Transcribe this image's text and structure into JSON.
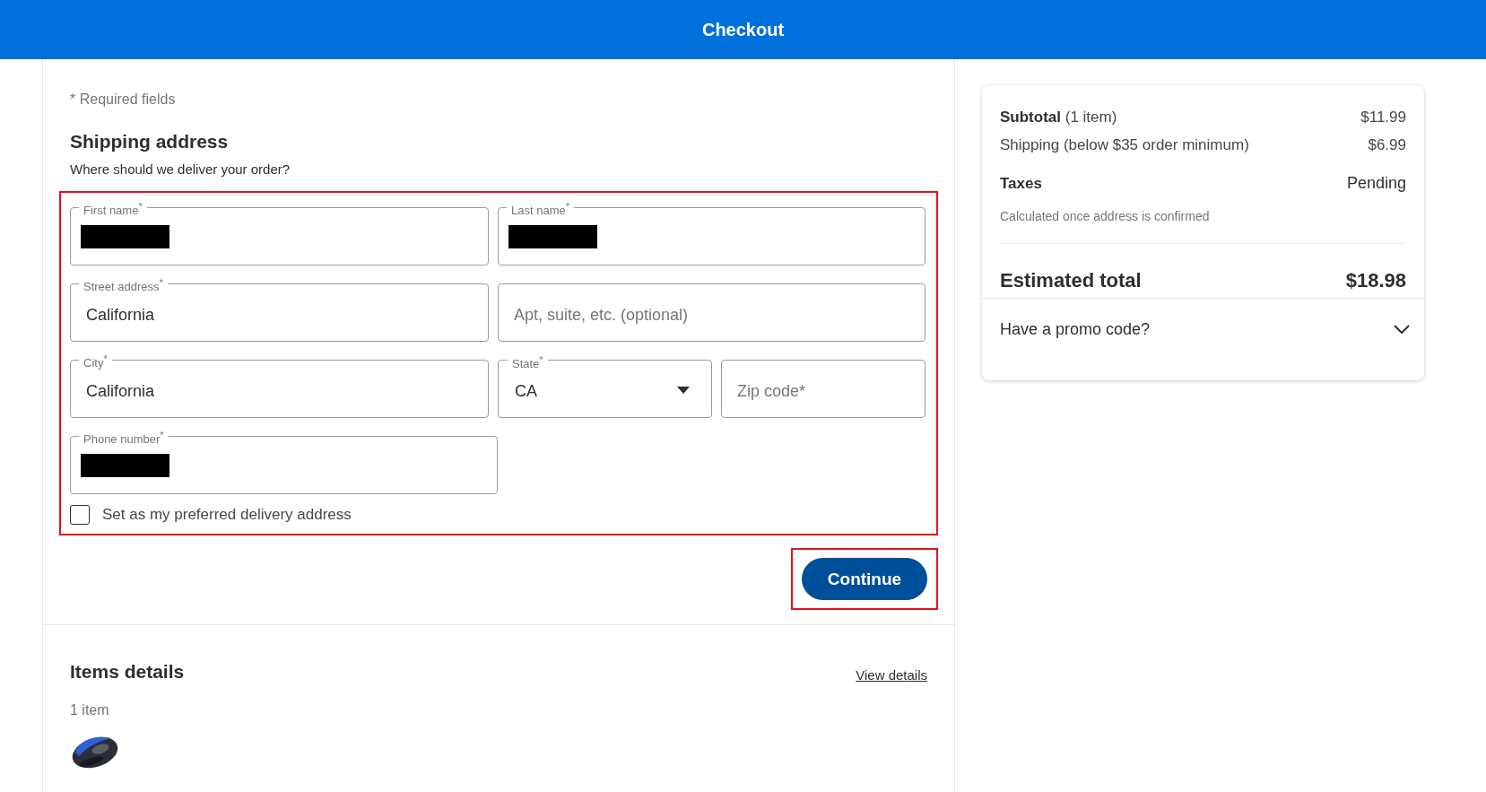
{
  "header": {
    "title": "Checkout"
  },
  "form": {
    "required_note": "* Required fields",
    "title": "Shipping address",
    "subtitle": "Where should we deliver your order?",
    "highlighted": true,
    "fields": [
      {
        "kind": "text",
        "label": "First name$^{*}$",
        "redacted": true
      },
      {
        "kind": "text",
        "label": "Last name$^{*}$",
        "redacted": true
      },
      {
        "kind": "text",
        "label": "Street address$^{*}$",
        "value": "California"
      },
      {
        "kind": "text",
        "placeholder": "Apt, suite, etc. (optional)"
      },
      {
        "kind": "text",
        "label": "City$^{*}$",
        "value": "California"
      },
      {
        "kind": "select",
        "label": "State$^{*}$",
        "value": "CA"
      },
      {
        "kind": "text",
        "placeholder": "Zip code*"
      },
      {
        "kind": "text",
        "label": "Phone number$^{*}$",
        "redacted": true
      }
    ],
    "preferred": {
      "label": "Set as my preferred delivery address",
      "checked": false
    }
  },
  "continue_button": {
    "label": "Continue",
    "highlighted": true
  },
  "items": {
    "title": "Items details",
    "link": "View details",
    "count": "1 item"
  },
  "summary": {
    "lines": [
      {
        "label": "**Subtotal** (1 item)",
        "value": "$11.99"
      },
      {
        "label": "Shipping (below $35 order minimum)",
        "value": "$6.99"
      }
    ],
    "taxes": {
      "label": "Taxes",
      "value": "Pending",
      "note": "Calculated once address is confirmed"
    },
    "total": {
      "label": "Estimated total",
      "value": "$18.98"
    },
    "promo": {
      "label": "Have a promo code?",
      "expanded": false
    }
  }
}
